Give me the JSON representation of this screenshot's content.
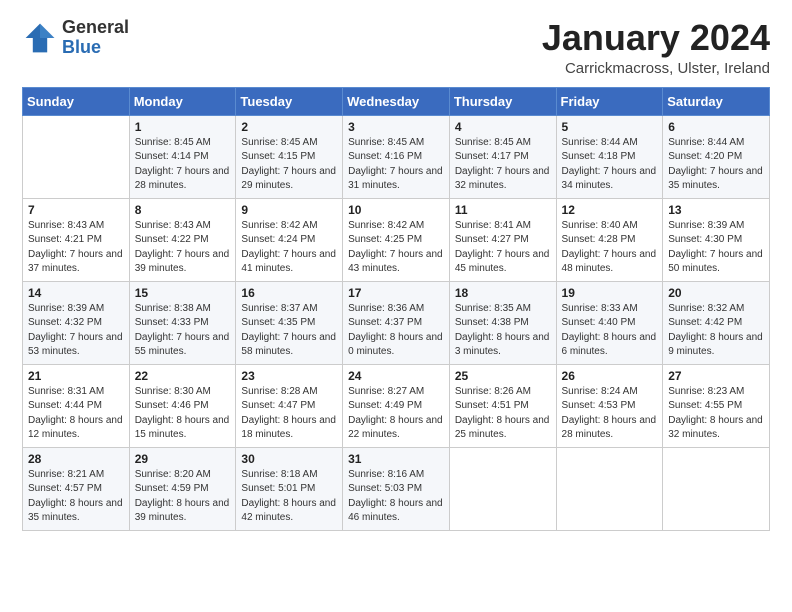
{
  "logo": {
    "general": "General",
    "blue": "Blue"
  },
  "header": {
    "month": "January 2024",
    "location": "Carrickmacross, Ulster, Ireland"
  },
  "days_of_week": [
    "Sunday",
    "Monday",
    "Tuesday",
    "Wednesday",
    "Thursday",
    "Friday",
    "Saturday"
  ],
  "weeks": [
    [
      {
        "day": null,
        "sunrise": null,
        "sunset": null,
        "daylight": null
      },
      {
        "day": "1",
        "sunrise": "Sunrise: 8:45 AM",
        "sunset": "Sunset: 4:14 PM",
        "daylight": "Daylight: 7 hours and 28 minutes."
      },
      {
        "day": "2",
        "sunrise": "Sunrise: 8:45 AM",
        "sunset": "Sunset: 4:15 PM",
        "daylight": "Daylight: 7 hours and 29 minutes."
      },
      {
        "day": "3",
        "sunrise": "Sunrise: 8:45 AM",
        "sunset": "Sunset: 4:16 PM",
        "daylight": "Daylight: 7 hours and 31 minutes."
      },
      {
        "day": "4",
        "sunrise": "Sunrise: 8:45 AM",
        "sunset": "Sunset: 4:17 PM",
        "daylight": "Daylight: 7 hours and 32 minutes."
      },
      {
        "day": "5",
        "sunrise": "Sunrise: 8:44 AM",
        "sunset": "Sunset: 4:18 PM",
        "daylight": "Daylight: 7 hours and 34 minutes."
      },
      {
        "day": "6",
        "sunrise": "Sunrise: 8:44 AM",
        "sunset": "Sunset: 4:20 PM",
        "daylight": "Daylight: 7 hours and 35 minutes."
      }
    ],
    [
      {
        "day": "7",
        "sunrise": "Sunrise: 8:43 AM",
        "sunset": "Sunset: 4:21 PM",
        "daylight": "Daylight: 7 hours and 37 minutes."
      },
      {
        "day": "8",
        "sunrise": "Sunrise: 8:43 AM",
        "sunset": "Sunset: 4:22 PM",
        "daylight": "Daylight: 7 hours and 39 minutes."
      },
      {
        "day": "9",
        "sunrise": "Sunrise: 8:42 AM",
        "sunset": "Sunset: 4:24 PM",
        "daylight": "Daylight: 7 hours and 41 minutes."
      },
      {
        "day": "10",
        "sunrise": "Sunrise: 8:42 AM",
        "sunset": "Sunset: 4:25 PM",
        "daylight": "Daylight: 7 hours and 43 minutes."
      },
      {
        "day": "11",
        "sunrise": "Sunrise: 8:41 AM",
        "sunset": "Sunset: 4:27 PM",
        "daylight": "Daylight: 7 hours and 45 minutes."
      },
      {
        "day": "12",
        "sunrise": "Sunrise: 8:40 AM",
        "sunset": "Sunset: 4:28 PM",
        "daylight": "Daylight: 7 hours and 48 minutes."
      },
      {
        "day": "13",
        "sunrise": "Sunrise: 8:39 AM",
        "sunset": "Sunset: 4:30 PM",
        "daylight": "Daylight: 7 hours and 50 minutes."
      }
    ],
    [
      {
        "day": "14",
        "sunrise": "Sunrise: 8:39 AM",
        "sunset": "Sunset: 4:32 PM",
        "daylight": "Daylight: 7 hours and 53 minutes."
      },
      {
        "day": "15",
        "sunrise": "Sunrise: 8:38 AM",
        "sunset": "Sunset: 4:33 PM",
        "daylight": "Daylight: 7 hours and 55 minutes."
      },
      {
        "day": "16",
        "sunrise": "Sunrise: 8:37 AM",
        "sunset": "Sunset: 4:35 PM",
        "daylight": "Daylight: 7 hours and 58 minutes."
      },
      {
        "day": "17",
        "sunrise": "Sunrise: 8:36 AM",
        "sunset": "Sunset: 4:37 PM",
        "daylight": "Daylight: 8 hours and 0 minutes."
      },
      {
        "day": "18",
        "sunrise": "Sunrise: 8:35 AM",
        "sunset": "Sunset: 4:38 PM",
        "daylight": "Daylight: 8 hours and 3 minutes."
      },
      {
        "day": "19",
        "sunrise": "Sunrise: 8:33 AM",
        "sunset": "Sunset: 4:40 PM",
        "daylight": "Daylight: 8 hours and 6 minutes."
      },
      {
        "day": "20",
        "sunrise": "Sunrise: 8:32 AM",
        "sunset": "Sunset: 4:42 PM",
        "daylight": "Daylight: 8 hours and 9 minutes."
      }
    ],
    [
      {
        "day": "21",
        "sunrise": "Sunrise: 8:31 AM",
        "sunset": "Sunset: 4:44 PM",
        "daylight": "Daylight: 8 hours and 12 minutes."
      },
      {
        "day": "22",
        "sunrise": "Sunrise: 8:30 AM",
        "sunset": "Sunset: 4:46 PM",
        "daylight": "Daylight: 8 hours and 15 minutes."
      },
      {
        "day": "23",
        "sunrise": "Sunrise: 8:28 AM",
        "sunset": "Sunset: 4:47 PM",
        "daylight": "Daylight: 8 hours and 18 minutes."
      },
      {
        "day": "24",
        "sunrise": "Sunrise: 8:27 AM",
        "sunset": "Sunset: 4:49 PM",
        "daylight": "Daylight: 8 hours and 22 minutes."
      },
      {
        "day": "25",
        "sunrise": "Sunrise: 8:26 AM",
        "sunset": "Sunset: 4:51 PM",
        "daylight": "Daylight: 8 hours and 25 minutes."
      },
      {
        "day": "26",
        "sunrise": "Sunrise: 8:24 AM",
        "sunset": "Sunset: 4:53 PM",
        "daylight": "Daylight: 8 hours and 28 minutes."
      },
      {
        "day": "27",
        "sunrise": "Sunrise: 8:23 AM",
        "sunset": "Sunset: 4:55 PM",
        "daylight": "Daylight: 8 hours and 32 minutes."
      }
    ],
    [
      {
        "day": "28",
        "sunrise": "Sunrise: 8:21 AM",
        "sunset": "Sunset: 4:57 PM",
        "daylight": "Daylight: 8 hours and 35 minutes."
      },
      {
        "day": "29",
        "sunrise": "Sunrise: 8:20 AM",
        "sunset": "Sunset: 4:59 PM",
        "daylight": "Daylight: 8 hours and 39 minutes."
      },
      {
        "day": "30",
        "sunrise": "Sunrise: 8:18 AM",
        "sunset": "Sunset: 5:01 PM",
        "daylight": "Daylight: 8 hours and 42 minutes."
      },
      {
        "day": "31",
        "sunrise": "Sunrise: 8:16 AM",
        "sunset": "Sunset: 5:03 PM",
        "daylight": "Daylight: 8 hours and 46 minutes."
      },
      {
        "day": null,
        "sunrise": null,
        "sunset": null,
        "daylight": null
      },
      {
        "day": null,
        "sunrise": null,
        "sunset": null,
        "daylight": null
      },
      {
        "day": null,
        "sunrise": null,
        "sunset": null,
        "daylight": null
      }
    ]
  ]
}
